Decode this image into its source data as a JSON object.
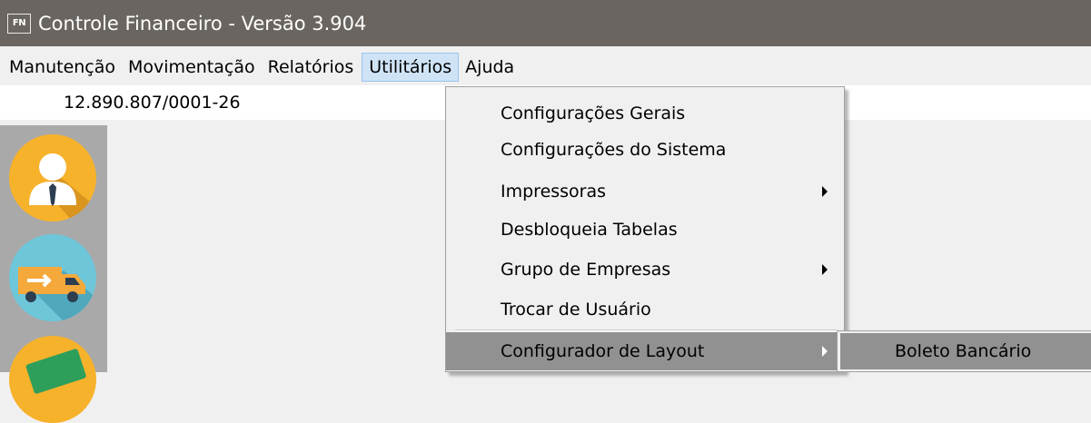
{
  "window": {
    "icon_text": "FN",
    "title": "Controle Financeiro - Versão 3.904"
  },
  "menubar": {
    "items": [
      "Manutenção",
      "Movimentação",
      "Relatórios",
      "Utilitários",
      "Ajuda"
    ],
    "open_item": "Utilitários"
  },
  "info": {
    "cnpj": "12.890.807/0001-26"
  },
  "sidebar": {
    "buttons": [
      "user-icon",
      "truck-icon",
      "money-icon"
    ]
  },
  "utilitarios_menu": {
    "items": [
      {
        "label": "Configurações Gerais",
        "has_submenu": false
      },
      {
        "label": "Configurações do Sistema",
        "has_submenu": false
      },
      {
        "label": "Impressoras",
        "has_submenu": true
      },
      {
        "label": "Desbloqueia Tabelas",
        "has_submenu": false
      },
      {
        "label": "Grupo de Empresas",
        "has_submenu": true
      },
      {
        "label": "Trocar de Usuário",
        "has_submenu": false
      },
      {
        "label": "Configurador de Layout",
        "has_submenu": true,
        "highlighted": true
      }
    ]
  },
  "layout_submenu": {
    "items": [
      {
        "label": "Boleto Bancário",
        "highlighted": true
      }
    ]
  },
  "colors": {
    "titlebar": "#6a6560",
    "sidebar": "#a9a9a9",
    "highlight": "#919191",
    "menu_open": "#cfe3f7"
  }
}
